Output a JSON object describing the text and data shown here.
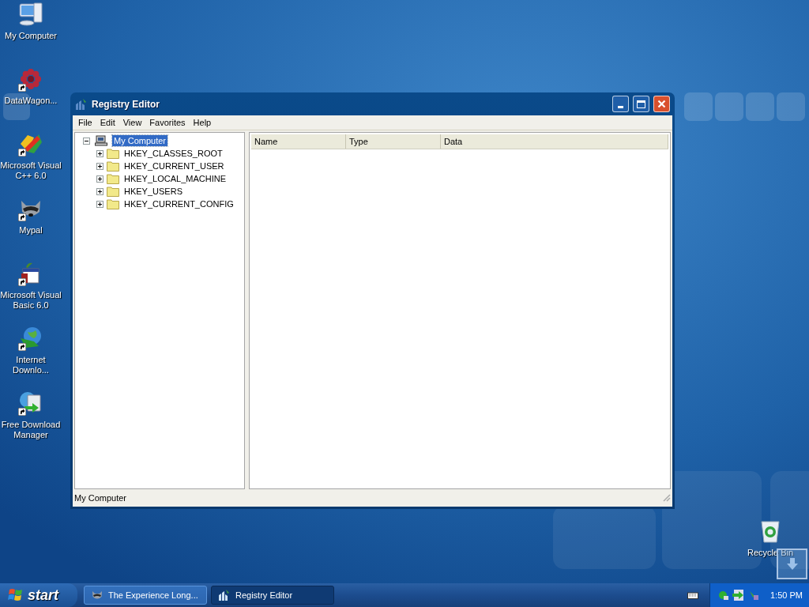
{
  "desktop_icons": [
    {
      "label": "My Computer",
      "kind": "computer",
      "shortcut": false
    },
    {
      "label": "DataWagon...",
      "kind": "flower",
      "shortcut": true
    },
    {
      "label": "Microsoft Visual C++ 6.0",
      "kind": "palette",
      "shortcut": true
    },
    {
      "label": "Mypal",
      "kind": "raccoon",
      "shortcut": true
    },
    {
      "label": "Microsoft Visual Basic 6.0",
      "kind": "calendar",
      "shortcut": true
    },
    {
      "label": "Internet Downlo...",
      "kind": "globe",
      "shortcut": true
    },
    {
      "label": "Free Download Manager",
      "kind": "download",
      "shortcut": true
    }
  ],
  "recycle_bin": {
    "label": "Recycle Bin"
  },
  "window": {
    "title": "Registry Editor",
    "menu": [
      "File",
      "Edit",
      "View",
      "Favorites",
      "Help"
    ],
    "tree": {
      "label": "My Computer",
      "selected": true,
      "expanded": true,
      "children": [
        {
          "label": "HKEY_CLASSES_ROOT",
          "expanded": false
        },
        {
          "label": "HKEY_CURRENT_USER",
          "expanded": false
        },
        {
          "label": "HKEY_LOCAL_MACHINE",
          "expanded": false
        },
        {
          "label": "HKEY_USERS",
          "expanded": false
        },
        {
          "label": "HKEY_CURRENT_CONFIG",
          "expanded": false
        }
      ]
    },
    "columns": [
      "Name",
      "Type",
      "Data"
    ],
    "status_bar": "My Computer"
  },
  "taskbar": {
    "start": "start",
    "tasks": [
      {
        "label": "The Experience Long...",
        "kind": "raccoon",
        "selected": false
      },
      {
        "label": "Registry Editor",
        "kind": "registry",
        "selected": true
      }
    ],
    "clock": "1:50 PM"
  }
}
